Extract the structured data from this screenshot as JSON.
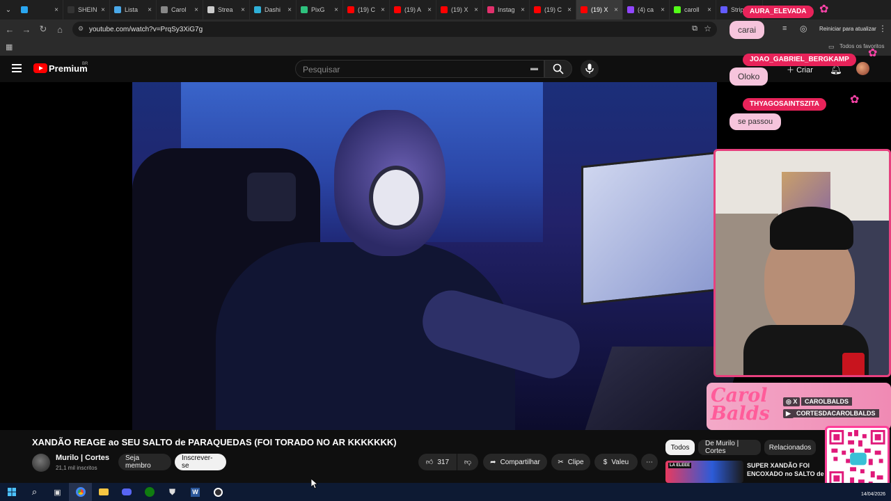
{
  "browser": {
    "tabs": [
      {
        "label": "",
        "color": "#2aa6f0"
      },
      {
        "label": "SHEIN",
        "color": "#333333"
      },
      {
        "label": "Lista",
        "color": "#4aa8e8"
      },
      {
        "label": "Carol",
        "color": "#888888"
      },
      {
        "label": "Strea",
        "color": "#cccccc"
      },
      {
        "label": "Dashi",
        "color": "#2fb0d8"
      },
      {
        "label": "PixG",
        "color": "#2ec27e"
      },
      {
        "label": "(19) C",
        "color": "#ff0000"
      },
      {
        "label": "(19) A",
        "color": "#ff0000"
      },
      {
        "label": "(19) X",
        "color": "#ff0000"
      },
      {
        "label": "Instag",
        "color": "#e1306c"
      },
      {
        "label": "(19) C",
        "color": "#ff0000"
      },
      {
        "label": "(19) X",
        "color": "#ff0000",
        "active": true
      },
      {
        "label": "(4) ca",
        "color": "#9146ff"
      },
      {
        "label": "caroll",
        "color": "#53fc18"
      },
      {
        "label": "Stripe",
        "color": "#635bff"
      }
    ],
    "url": "youtube.com/watch?v=PrqSy3XiG7g",
    "relaunch_label": "Reiniciar para atualizar",
    "bookmarks_label": "Todos os favoritos"
  },
  "youtube": {
    "logo_text": "Premium",
    "logo_region": "BR",
    "search_placeholder": "Pesquisar",
    "create_label": "Criar",
    "notif_count": "9+",
    "video_title": "XANDÃO REAGE ao SEU SALTO de PARAQUEDAS (FOI TORADO NO AR KKKKKKK)",
    "channel_name": "Murilo | Cortes",
    "subscribers": "21,1 mil inscritos",
    "join_label": "Seja membro",
    "subscribe_label": "Inscrever-se",
    "likes": "317",
    "share_label": "Compartilhar",
    "clip_label": "Clipe",
    "thanks_label": "Valeu",
    "filter_chips": [
      "Todos",
      "De Murilo | Cortes",
      "Relacionados"
    ],
    "recommended_title": "SUPER XANDÃO FOI ENCOXADO no SALTO de ...",
    "thumb_tag": "LA ELEEE"
  },
  "stream_overlay": {
    "chat": [
      {
        "user": "AURA_ELEVADA",
        "message": "carai"
      },
      {
        "user": "JOAO_GABRIEL_BERGKAMP",
        "message": "Oloko"
      },
      {
        "user": "THYAGOSAINTSZITA",
        "message": "se passou"
      }
    ],
    "brand": "Carol Balds",
    "social_1": "CAROLBALDS",
    "social_2": "CORTESDACAROLBALDS",
    "colors": {
      "accent": "#e8235a",
      "bubble": "#f6c4dc",
      "frame": "#e7407e"
    }
  },
  "taskbar": {
    "date": "14/04/2026"
  }
}
